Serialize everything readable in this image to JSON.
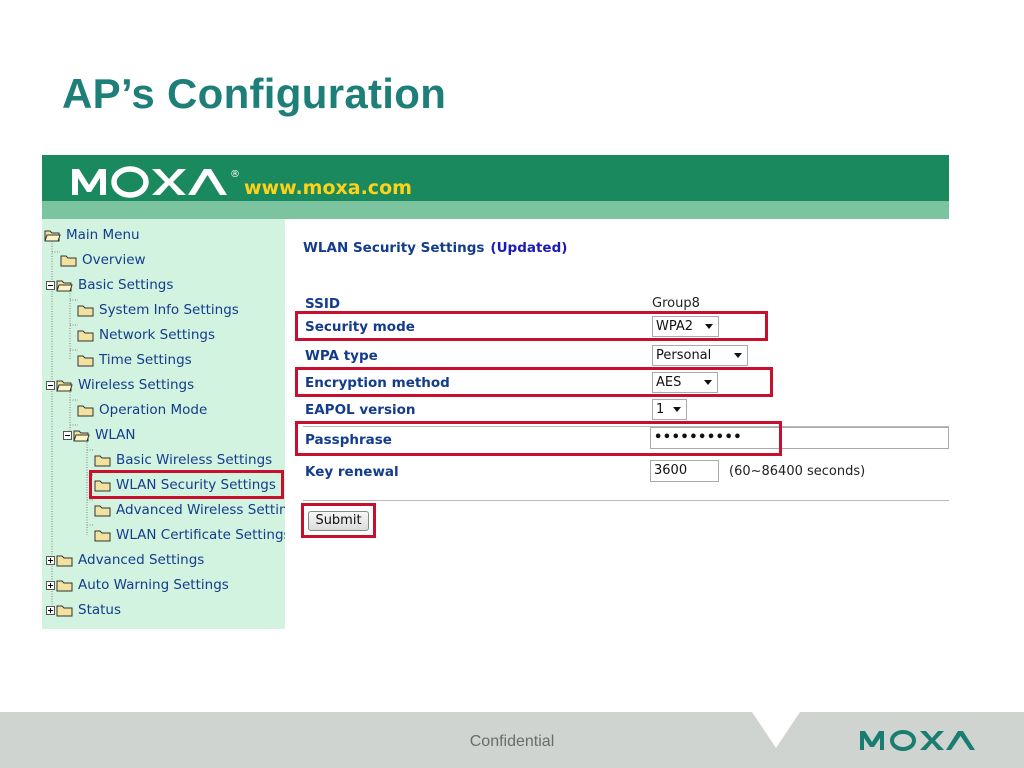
{
  "slide": {
    "title": "AP’s Configuration"
  },
  "banner": {
    "logo": "MOXA",
    "registered": "®",
    "url": "www.moxa.com"
  },
  "sidebar": {
    "items": [
      {
        "label": "Main Menu"
      },
      {
        "label": "Overview"
      },
      {
        "label": "Basic Settings"
      },
      {
        "label": "System Info Settings"
      },
      {
        "label": "Network Settings"
      },
      {
        "label": "Time Settings"
      },
      {
        "label": "Wireless Settings"
      },
      {
        "label": "Operation Mode"
      },
      {
        "label": "WLAN"
      },
      {
        "label": "Basic Wireless Settings"
      },
      {
        "label": "WLAN Security Settings"
      },
      {
        "label": "Advanced Wireless Settin"
      },
      {
        "label": "WLAN Certificate Settings"
      },
      {
        "label": "Advanced Settings"
      },
      {
        "label": "Auto Warning Settings"
      },
      {
        "label": "Status"
      }
    ]
  },
  "main": {
    "title": "WLAN Security Settings",
    "status": "(Updated)",
    "fields": {
      "ssid": {
        "label": "SSID",
        "value": "Group8"
      },
      "security_mode": {
        "label": "Security mode",
        "value": "WPA2"
      },
      "wpa_type": {
        "label": "WPA type",
        "value": "Personal"
      },
      "encryption": {
        "label": "Encryption method",
        "value": "AES"
      },
      "eapol": {
        "label": "EAPOL version",
        "value": "1"
      },
      "passphrase": {
        "label": "Passphrase",
        "value": "••••••••••"
      },
      "key_renewal": {
        "label": "Key renewal",
        "value": "3600",
        "hint": "(60~86400 seconds)"
      }
    },
    "submit": "Submit"
  },
  "footer": {
    "text": "Confidential",
    "logo": "MOXA"
  },
  "colors": {
    "title": "#1d7f78",
    "banner": "#1a8a5e",
    "sidebar": "#d2f3df",
    "highlight": "#c8102e",
    "url": "#ffd21a"
  }
}
